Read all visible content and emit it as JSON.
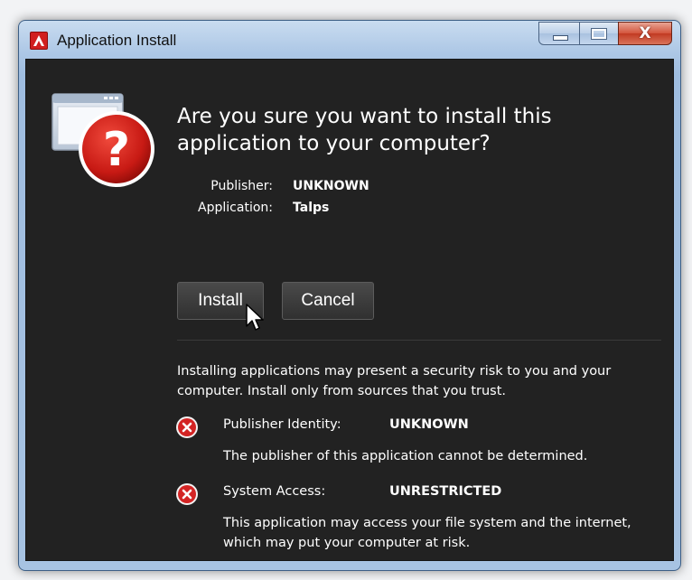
{
  "window": {
    "title": "Application Install",
    "controls": {
      "close_glyph": "X"
    }
  },
  "dialog": {
    "question": "Are you sure you want to install this application to your computer?",
    "publisher_label": "Publisher:",
    "publisher_value": "UNKNOWN",
    "application_label": "Application:",
    "application_value": "Talps"
  },
  "buttons": {
    "install_label": "Install",
    "cancel_label": "Cancel"
  },
  "security": {
    "warning": "Installing applications may present a security risk to you and your computer. Install only from sources that you trust.",
    "items": [
      {
        "label": "Publisher Identity:",
        "value": "UNKNOWN",
        "description": "The publisher of this application cannot be determined.",
        "icon": "error-x-icon"
      },
      {
        "label": "System Access:",
        "value": "UNRESTRICTED",
        "description": "This application may access your file system and the internet, which may put your computer at risk.",
        "icon": "error-x-icon"
      }
    ]
  },
  "colors": {
    "dialog_background": "#222222",
    "titlebar": "#aec8e6",
    "close_button": "#c23a22",
    "warning_red": "#d32424"
  }
}
